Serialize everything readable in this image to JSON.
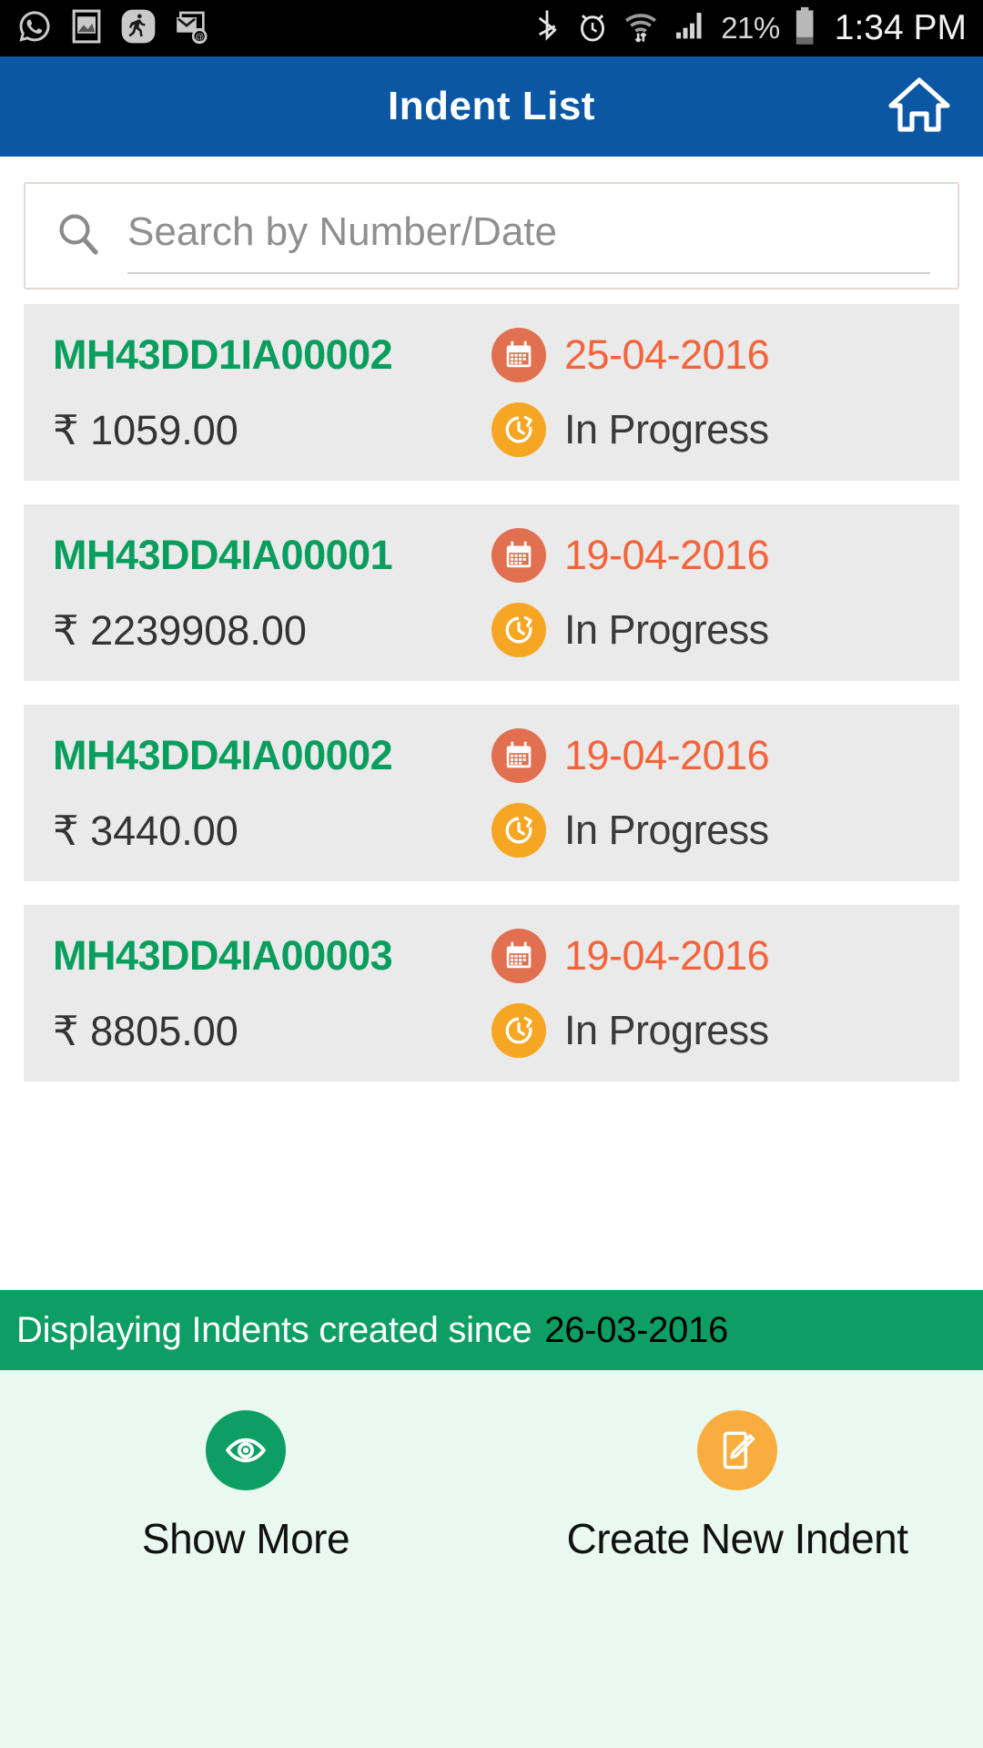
{
  "statusbar": {
    "left_icons": [
      "whatsapp-icon",
      "screenshot-icon",
      "fitness-running-icon",
      "email-icon"
    ],
    "right_icons": [
      "bluetooth-icon",
      "alarm-icon",
      "wifi-icon",
      "signal-icon"
    ],
    "battery_percent": "21%",
    "time": "1:34 PM"
  },
  "appbar": {
    "title": "Indent List",
    "home_icon": "home-icon",
    "background": "#0b57a4"
  },
  "search": {
    "placeholder": "Search by Number/Date",
    "value": "",
    "icon": "search-icon"
  },
  "colors": {
    "indent_green": "#0a9e5e",
    "date_orange": "#f4633a",
    "calendar_badge": "#e07050",
    "clock_badge": "#f6a623",
    "banner_green": "#0d9e64",
    "edit_badge": "#f8ad3e"
  },
  "indents": [
    {
      "number": "MH43DD1IA00002",
      "date": "25-04-2016",
      "amount": "₹ 1059.00",
      "status": "In Progress",
      "date_icon": "calendar-icon",
      "status_icon": "clock-icon"
    },
    {
      "number": "MH43DD4IA00001",
      "date": "19-04-2016",
      "amount": "₹ 2239908.00",
      "status": "In Progress",
      "date_icon": "calendar-icon",
      "status_icon": "clock-icon"
    },
    {
      "number": "MH43DD4IA00002",
      "date": "19-04-2016",
      "amount": "₹ 3440.00",
      "status": "In Progress",
      "date_icon": "calendar-icon",
      "status_icon": "clock-icon"
    },
    {
      "number": "MH43DD4IA00003",
      "date": "19-04-2016",
      "amount": "₹ 8805.00",
      "status": "In Progress",
      "date_icon": "calendar-icon",
      "status_icon": "clock-icon"
    }
  ],
  "banner": {
    "text": "Displaying Indents created since",
    "date": "26-03-2016"
  },
  "actions": {
    "show_more": {
      "label": "Show More",
      "icon": "eye-icon"
    },
    "create_new": {
      "label": "Create New Indent",
      "icon": "edit-pencil-icon"
    }
  }
}
